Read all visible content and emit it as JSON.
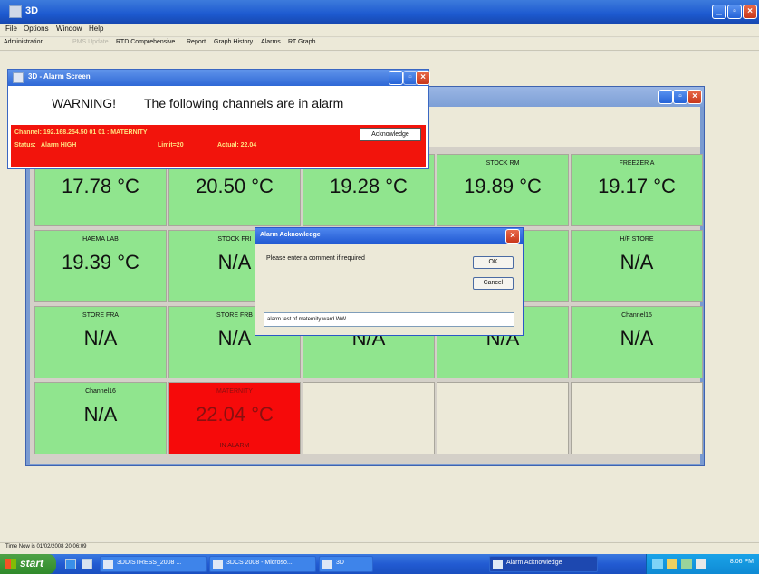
{
  "window": {
    "title": "3D"
  },
  "menubar": {
    "items": [
      "File",
      "Options",
      "Window",
      "Help"
    ]
  },
  "toolbar": {
    "items": [
      {
        "label": "Administration",
        "enabled": true
      },
      {
        "label": "PMS Update",
        "enabled": false
      },
      {
        "label": "RTD Comprehensive",
        "enabled": true
      },
      {
        "label": "Report",
        "enabled": true
      },
      {
        "label": "Graph History",
        "enabled": true
      },
      {
        "label": "Alarms",
        "enabled": true
      },
      {
        "label": "RT Graph",
        "enabled": true
      }
    ]
  },
  "tiles": [
    {
      "channel": "",
      "value": "17.78 °C"
    },
    {
      "channel": "",
      "value": "20.50 °C"
    },
    {
      "channel": "",
      "value": "19.28 °C"
    },
    {
      "channel": "STOCK RM",
      "value": "19.89 °C"
    },
    {
      "channel": "FREEZER A",
      "value": "19.17 °C"
    },
    {
      "channel": "HAEMA LAB",
      "value": "19.39 °C"
    },
    {
      "channel": "STOCK FRI",
      "value": "N/A"
    },
    {
      "channel": "",
      "value": ""
    },
    {
      "channel": "",
      "value": ""
    },
    {
      "channel": "H/F STORE",
      "value": "N/A"
    },
    {
      "channel": "STORE FRA",
      "value": "N/A"
    },
    {
      "channel": "STORE FRB",
      "value": "N/A"
    },
    {
      "channel": "",
      "value": "N/A"
    },
    {
      "channel": "",
      "value": "N/A"
    },
    {
      "channel": "Channel15",
      "value": "N/A"
    },
    {
      "channel": "Channel16",
      "value": "N/A"
    },
    {
      "channel": "MATERNITY",
      "value": "22.04 °C",
      "sub": "IN ALARM",
      "alarm": true
    }
  ],
  "alarm_screen": {
    "title": "3D - Alarm Screen",
    "warning": "WARNING!",
    "message": "The following channels are in alarm",
    "channel_line": "Channel: 192.168.254.50 01 01 : MATERNITY",
    "status_label": "Status:",
    "status_value": "Alarm HIGH",
    "limit": "Limit=20",
    "actual": "Actual: 22.04",
    "ack_button": "Acknowledge"
  },
  "dialog": {
    "title": "Alarm Acknowledge",
    "prompt": "Please enter a comment if required",
    "ok": "OK",
    "cancel": "Cancel",
    "comment_value": "alarm test of maternity ward WW"
  },
  "statusbar": {
    "text": "Time Now is 01/02/2008 20:06:09"
  },
  "taskbar": {
    "start": "start",
    "buttons": [
      {
        "label": "3DDISTRESS_2008 ...",
        "active": false
      },
      {
        "label": "3DCS 2008 - Microso...",
        "active": false
      },
      {
        "label": "3D",
        "active": false
      },
      {
        "label": "Alarm Acknowledge",
        "active": true
      }
    ],
    "time": "8:06 PM"
  },
  "colors": {
    "tile_ok": "#90e58e",
    "tile_alarm": "#f60a0a",
    "alarm_band": "#f2140c",
    "xp_blue": "#225bd2"
  }
}
